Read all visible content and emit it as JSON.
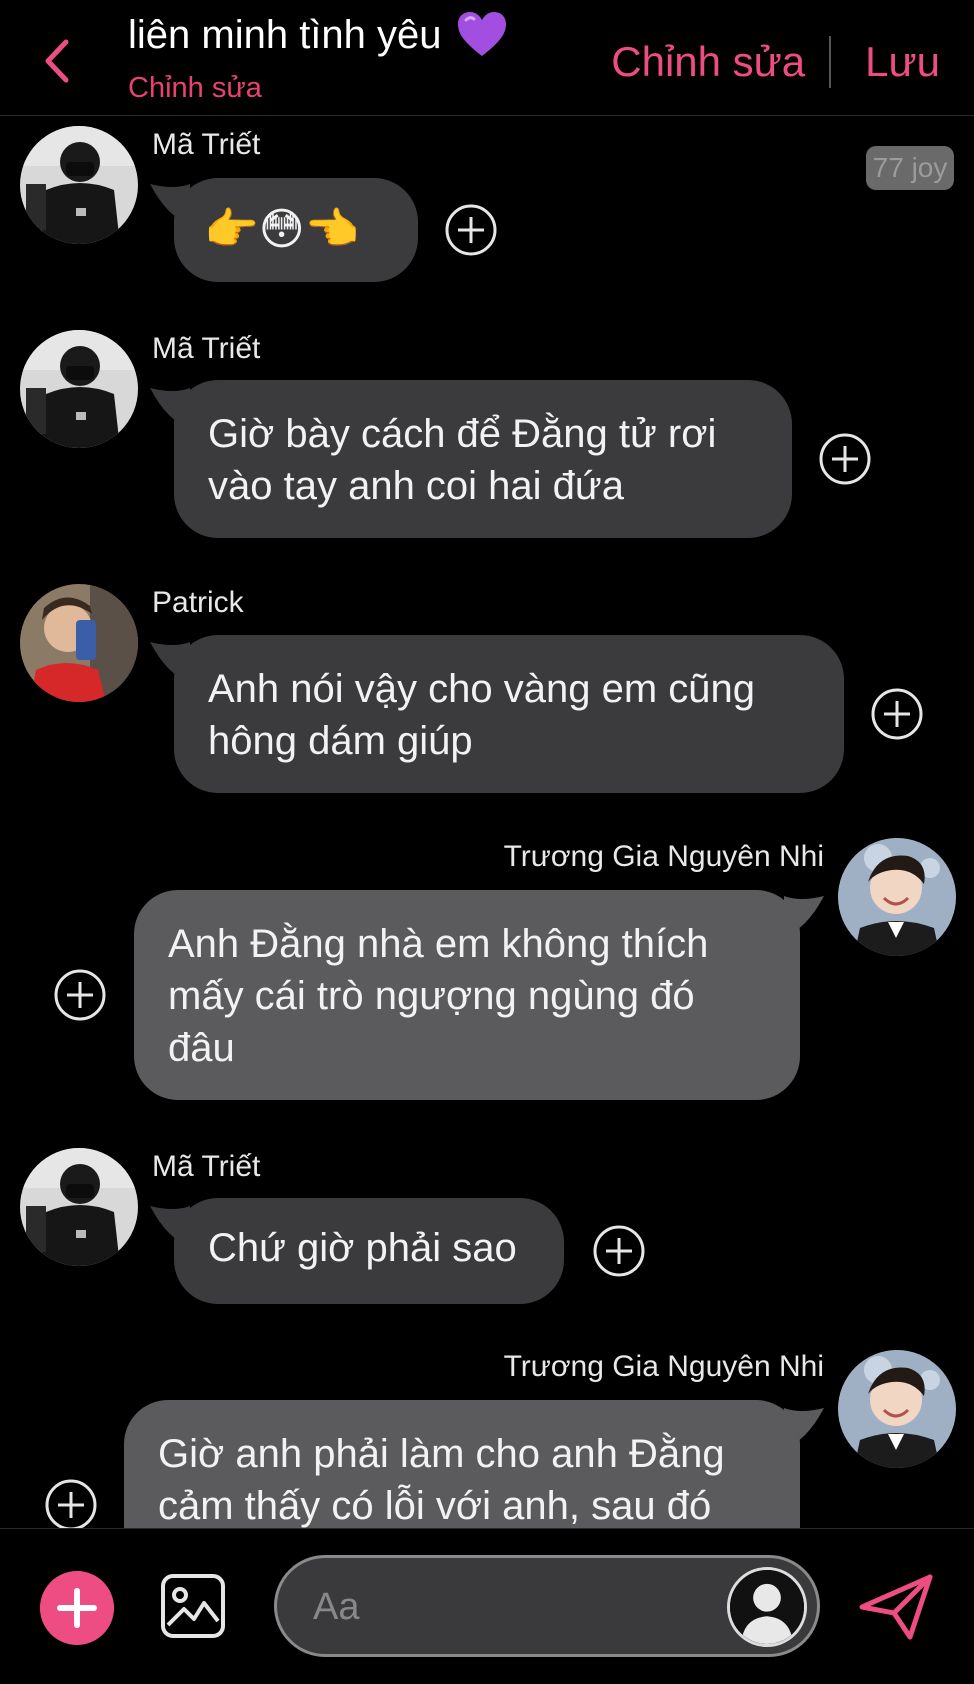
{
  "header": {
    "title": "liên minh tình yêu",
    "subtitle": "Chỉnh sửa",
    "edit_label": "Chỉnh sửa",
    "save_label": "Lưu"
  },
  "joy_badge": "77 joy",
  "messages": [
    {
      "sender": "Mã Triết",
      "text": "👉😳👈"
    },
    {
      "sender": "Mã Triết",
      "lines": [
        "Giờ bày cách để Đằng tử rơi",
        "vào tay anh coi hai đứa"
      ]
    },
    {
      "sender": "Patrick",
      "lines": [
        "Anh nói vậy cho vàng em cũng",
        "hông dám giúp"
      ]
    },
    {
      "sender": "Trương Gia Nguyên Nhi",
      "lines": [
        "Anh Đằng nhà em không thích",
        "mấy cái trò ngượng ngùng đó",
        "đâu"
      ]
    },
    {
      "sender": "Mã Triết",
      "lines": [
        "Chứ giờ phải sao"
      ]
    },
    {
      "sender": "Trương Gia Nguyên Nhi",
      "lines": [
        "Giờ anh phải làm cho anh Đằng",
        "cảm thấy có lỗi với anh, sau đó"
      ]
    }
  ],
  "composer": {
    "placeholder": "Aa"
  },
  "colors": {
    "accent": "#ee4d83",
    "subtitle": "#e8426e",
    "bubble_incoming": "#3b3b3d",
    "bubble_outgoing": "#5b5b5e",
    "background": "#000000"
  },
  "icons": [
    "back-chevron-icon",
    "purple-heart-icon",
    "add-reaction-icon",
    "add-icon",
    "image-icon",
    "profile-icon",
    "send-icon"
  ]
}
